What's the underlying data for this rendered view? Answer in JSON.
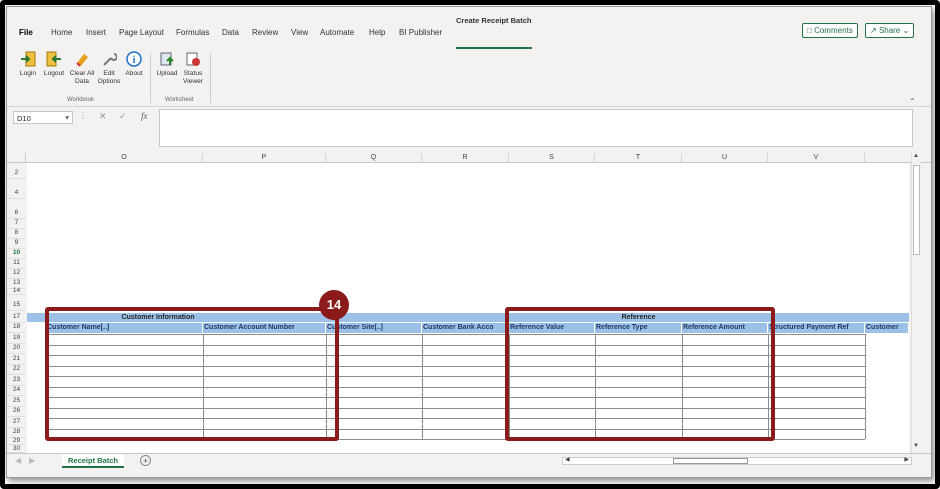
{
  "menu": {
    "items": [
      "File",
      "Home",
      "Insert",
      "Page Layout",
      "Formulas",
      "Data",
      "Review",
      "View",
      "Automate",
      "Help",
      "BI Publisher"
    ],
    "plugin_tab": "Create Receipt Batch",
    "comments_label": "Comments",
    "share_label": "Share"
  },
  "ribbon": {
    "buttons": [
      {
        "label": "Login",
        "icon": "login-icon"
      },
      {
        "label": "Logout",
        "icon": "logout-icon"
      },
      {
        "label": "Clear All Data",
        "icon": "eraser-icon"
      },
      {
        "label": "Edit Options",
        "icon": "wrench-icon"
      },
      {
        "label": "About",
        "icon": "info-icon"
      },
      {
        "label": "Upload",
        "icon": "upload-icon"
      },
      {
        "label": "Status Viewer",
        "icon": "status-viewer-icon"
      }
    ],
    "group_workbook": "Workbook",
    "group_worksheet": "Worksheet"
  },
  "formula_bar": {
    "cell_ref": "D10",
    "fx": "fx"
  },
  "columns": [
    "O",
    "P",
    "Q",
    "R",
    "S",
    "T",
    "U",
    "V"
  ],
  "rows": [
    "2",
    "4",
    "6",
    "7",
    "8",
    "9",
    "10",
    "11",
    "12",
    "13",
    "14",
    "15",
    "17",
    "18",
    "19",
    "20",
    "21",
    "22",
    "23",
    "24",
    "25",
    "26",
    "27",
    "28",
    "29",
    "30"
  ],
  "sheet": {
    "section_customer": "Customer Information",
    "section_reference": "Reference",
    "headers": [
      "Customer Name[..]",
      "Customer Account Number",
      "Customer Site[..]",
      "Customer Bank Acco",
      "Reference Value",
      "Reference Type",
      "Reference Amount",
      "Structured Payment Ref",
      "Customer"
    ]
  },
  "annotation_badge": "14",
  "tabs": {
    "active": "Receipt Batch"
  },
  "colors": {
    "header_blue": "#9bc2e6",
    "annotation_red": "#8b1a1a",
    "excel_green": "#217346"
  }
}
